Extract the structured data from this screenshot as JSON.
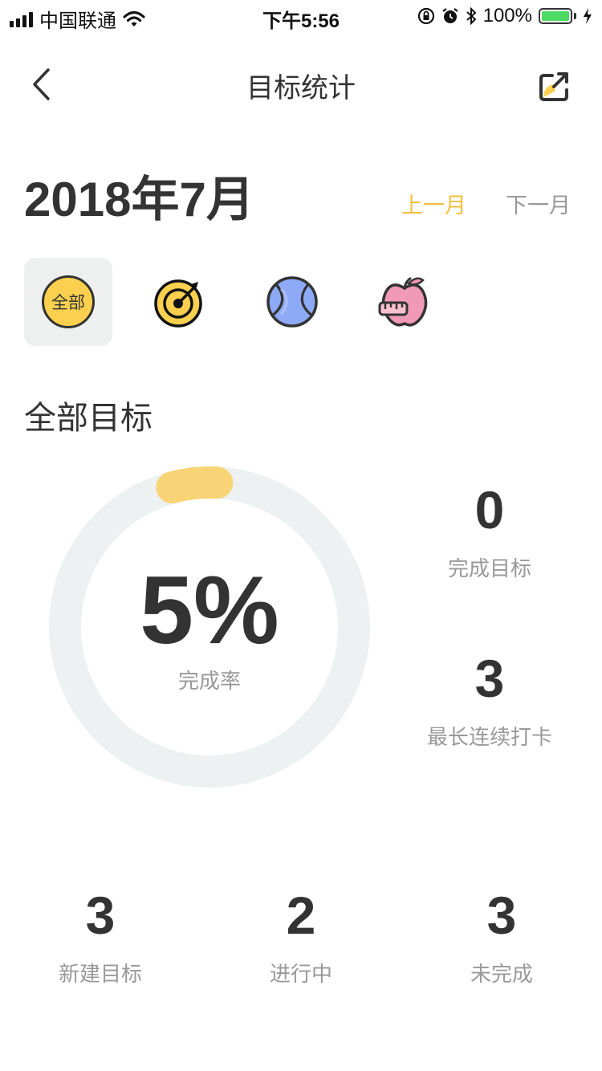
{
  "status_bar": {
    "carrier": "中国联通",
    "time": "下午5:56",
    "battery": "100%"
  },
  "nav": {
    "title": "目标统计"
  },
  "month": {
    "title": "2018年7月",
    "prev": "上一月",
    "next": "下一月"
  },
  "categories": {
    "all_label": "全部",
    "icons": [
      "all-badge-icon",
      "target-icon",
      "tennis-ball-icon",
      "apple-tape-icon"
    ]
  },
  "section": {
    "title": "全部目标"
  },
  "completion": {
    "value": "5%",
    "fraction": 0.05,
    "label": "完成率"
  },
  "side_stats": [
    {
      "value": "0",
      "label": "完成目标"
    },
    {
      "value": "3",
      "label": "最长连续打卡"
    }
  ],
  "bottom_stats": [
    {
      "value": "3",
      "label": "新建目标"
    },
    {
      "value": "2",
      "label": "进行中"
    },
    {
      "value": "3",
      "label": "未完成"
    }
  ],
  "colors": {
    "accent": "#f5bf3d",
    "ring_track": "#eef1f1",
    "ring_progress": "#f8d477",
    "text_primary": "#333333",
    "text_secondary": "#999999"
  }
}
